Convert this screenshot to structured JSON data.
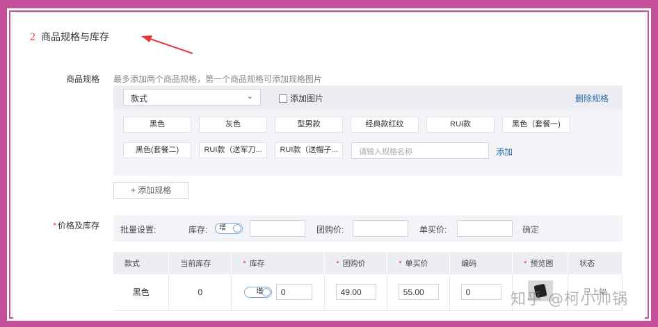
{
  "section": {
    "number": "2",
    "title": "商品规格与库存"
  },
  "spec": {
    "label": "商品规格",
    "hint": "最多添加两个商品规格，第一个商品规格可添加规格图片",
    "select_value": "款式",
    "add_image_label": "添加图片",
    "delete_label": "删除规格",
    "values": [
      "黑色",
      "灰色",
      "型男款",
      "经典款红纹",
      "RUI款",
      "黑色（套餐一)",
      "黑色(套餐二)",
      "RUI款（送军刀...",
      "RUI款（送帽子..."
    ],
    "input_placeholder": "请输入规格名称",
    "add_label": "添加",
    "add_spec_button": "+ 添加规格"
  },
  "price": {
    "label": "价格及库存",
    "batch_label": "批量设置:",
    "stock_label": "库存:",
    "toggle_label": "增",
    "group_price_label": "团购价:",
    "unit_price_label": "单买价:",
    "confirm_label": "确定"
  },
  "table": {
    "headers": [
      {
        "text": "款式",
        "required": false
      },
      {
        "text": "当前库存",
        "required": false
      },
      {
        "text": "库存",
        "required": true
      },
      {
        "text": "团购价",
        "required": true
      },
      {
        "text": "单买价",
        "required": true
      },
      {
        "text": "编码",
        "required": false
      },
      {
        "text": "预览图",
        "required": true
      },
      {
        "text": "状态",
        "required": false
      }
    ],
    "rows": [
      {
        "style": "黑色",
        "current_stock": "0",
        "toggle": "增",
        "stock": "0",
        "group_price": "49.00",
        "unit_price": "55.00",
        "code": "0",
        "status": "已上架"
      }
    ]
  },
  "watermark": "知乎 @柯小帅锅",
  "colors": {
    "frame": "#c4519a",
    "accent_red": "#e4393c",
    "link_blue": "#2d6aa6"
  }
}
